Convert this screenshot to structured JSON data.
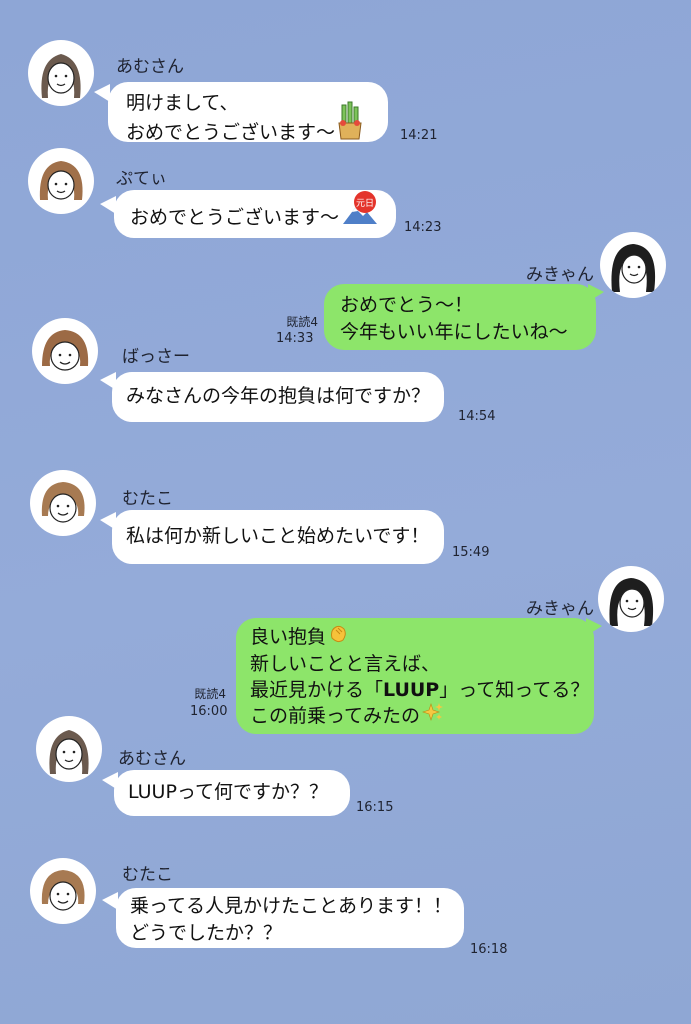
{
  "messages": [
    {
      "sender": "あむさん",
      "lines": [
        "明けまして、",
        "おめでとうございます〜"
      ],
      "emoji": "kadomatsu-icon",
      "time": "14:21"
    },
    {
      "sender": "ぷてぃ",
      "lines": [
        "おめでとうございます〜"
      ],
      "emoji": "new-year-fuji-icon",
      "emoji_text": "元日",
      "time": "14:23"
    },
    {
      "sender": "みきゃん",
      "lines": [
        "おめでとう〜！",
        "今年もいい年にしたいね〜"
      ],
      "read": "既読4",
      "time": "14:33"
    },
    {
      "sender": "ばっさー",
      "lines": [
        "みなさんの今年の抱負は何ですか？"
      ],
      "time": "14:54"
    },
    {
      "sender": "むたこ",
      "lines": [
        "私は何か新しいこと始めたいです！"
      ],
      "time": "15:49"
    },
    {
      "sender": "みきゃん",
      "lines": [
        "良い抱負",
        "新しいことと言えば、",
        "最近見かける「",
        "LUUP",
        "」って知ってる？",
        "この前乗ってみたの"
      ],
      "read": "既読4",
      "time": "16:00"
    },
    {
      "sender": "あむさん",
      "lines": [
        "LUUPって何ですか？？"
      ],
      "time": "16:15"
    },
    {
      "sender": "むたこ",
      "lines": [
        "乗ってる人見かけたことあります！！",
        "どうでしたか？？"
      ],
      "time": "16:18"
    }
  ],
  "colors": {
    "background": "#8ea6d6",
    "bubble_incoming": "#ffffff",
    "bubble_outgoing": "#8de56a"
  }
}
